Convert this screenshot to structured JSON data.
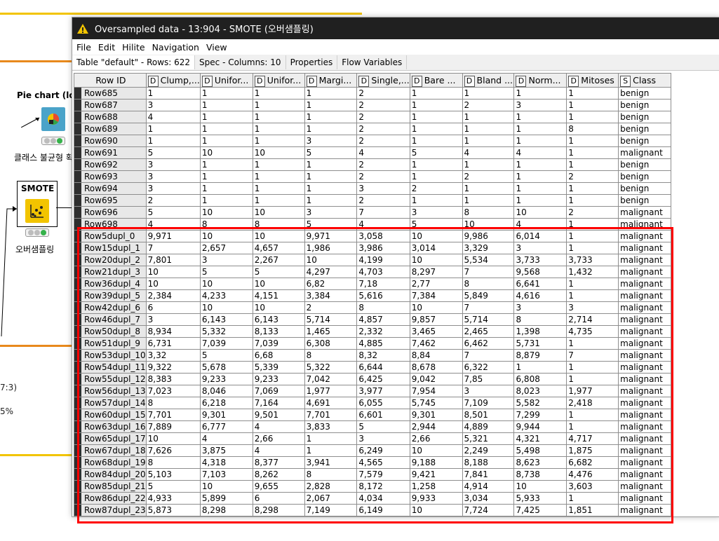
{
  "workflow": {
    "pie_node": {
      "title": "Pie chart (loca",
      "label": "클래스 불균형 확"
    },
    "smote_node": {
      "title": "SMOTE",
      "label": "오버샘플링"
    },
    "side_text": [
      "7:3)",
      "",
      "5%"
    ]
  },
  "window": {
    "title": "Oversampled data - 13:904 - SMOTE (오버샘플링)",
    "menu": [
      "File",
      "Edit",
      "Hilite",
      "Navigation",
      "View"
    ],
    "tabs": [
      "Table \"default\" - Rows: 622",
      "Spec - Columns: 10",
      "Properties",
      "Flow Variables"
    ]
  },
  "table": {
    "columns": [
      {
        "type": "",
        "name": "Row ID"
      },
      {
        "type": "D",
        "name": "Clump,..."
      },
      {
        "type": "D",
        "name": "Unifor..."
      },
      {
        "type": "D",
        "name": "Unifor..."
      },
      {
        "type": "D",
        "name": "Margi..."
      },
      {
        "type": "D",
        "name": "Single,..."
      },
      {
        "type": "D",
        "name": "Bare ..."
      },
      {
        "type": "D",
        "name": "Bland ..."
      },
      {
        "type": "D",
        "name": "Norm..."
      },
      {
        "type": "D",
        "name": "Mitoses"
      },
      {
        "type": "S",
        "name": "Class"
      }
    ],
    "rows": [
      [
        "Row685",
        "1",
        "1",
        "1",
        "1",
        "2",
        "1",
        "1",
        "1",
        "1",
        "benign"
      ],
      [
        "Row687",
        "3",
        "1",
        "1",
        "1",
        "2",
        "1",
        "2",
        "3",
        "1",
        "benign"
      ],
      [
        "Row688",
        "4",
        "1",
        "1",
        "1",
        "2",
        "1",
        "1",
        "1",
        "1",
        "benign"
      ],
      [
        "Row689",
        "1",
        "1",
        "1",
        "1",
        "2",
        "1",
        "1",
        "1",
        "8",
        "benign"
      ],
      [
        "Row690",
        "1",
        "1",
        "1",
        "3",
        "2",
        "1",
        "1",
        "1",
        "1",
        "benign"
      ],
      [
        "Row691",
        "5",
        "10",
        "10",
        "5",
        "4",
        "5",
        "4",
        "4",
        "1",
        "malignant"
      ],
      [
        "Row692",
        "3",
        "1",
        "1",
        "1",
        "2",
        "1",
        "1",
        "1",
        "1",
        "benign"
      ],
      [
        "Row693",
        "3",
        "1",
        "1",
        "1",
        "2",
        "1",
        "2",
        "1",
        "2",
        "benign"
      ],
      [
        "Row694",
        "3",
        "1",
        "1",
        "1",
        "3",
        "2",
        "1",
        "1",
        "1",
        "benign"
      ],
      [
        "Row695",
        "2",
        "1",
        "1",
        "1",
        "2",
        "1",
        "1",
        "1",
        "1",
        "benign"
      ],
      [
        "Row696",
        "5",
        "10",
        "10",
        "3",
        "7",
        "3",
        "8",
        "10",
        "2",
        "malignant"
      ],
      [
        "Row698",
        "4",
        "8",
        "8",
        "5",
        "4",
        "5",
        "10",
        "4",
        "1",
        "malignant"
      ],
      [
        "Row5dupl_0",
        "9,971",
        "10",
        "10",
        "9,971",
        "3,058",
        "10",
        "9,986",
        "6,014",
        "1",
        "malignant"
      ],
      [
        "Row15dupl_1",
        "7",
        "2,657",
        "4,657",
        "1,986",
        "3,986",
        "3,014",
        "3,329",
        "3",
        "1",
        "malignant"
      ],
      [
        "Row20dupl_2",
        "7,801",
        "3",
        "2,267",
        "10",
        "4,199",
        "10",
        "5,534",
        "3,733",
        "3,733",
        "malignant"
      ],
      [
        "Row21dupl_3",
        "10",
        "5",
        "5",
        "4,297",
        "4,703",
        "8,297",
        "7",
        "9,568",
        "1,432",
        "malignant"
      ],
      [
        "Row36dupl_4",
        "10",
        "10",
        "10",
        "6,82",
        "7,18",
        "2,77",
        "8",
        "6,641",
        "1",
        "malignant"
      ],
      [
        "Row39dupl_5",
        "2,384",
        "4,233",
        "4,151",
        "3,384",
        "5,616",
        "7,384",
        "5,849",
        "4,616",
        "1",
        "malignant"
      ],
      [
        "Row42dupl_6",
        "6",
        "10",
        "10",
        "2",
        "8",
        "10",
        "7",
        "3",
        "3",
        "malignant"
      ],
      [
        "Row46dupl_7",
        "3",
        "6,143",
        "6,143",
        "5,714",
        "4,857",
        "9,857",
        "5,714",
        "8",
        "2,714",
        "malignant"
      ],
      [
        "Row50dupl_8",
        "8,934",
        "5,332",
        "8,133",
        "1,465",
        "2,332",
        "3,465",
        "2,465",
        "1,398",
        "4,735",
        "malignant"
      ],
      [
        "Row51dupl_9",
        "6,731",
        "7,039",
        "7,039",
        "6,308",
        "4,885",
        "7,462",
        "6,462",
        "5,731",
        "1",
        "malignant"
      ],
      [
        "Row53dupl_10",
        "3,32",
        "5",
        "6,68",
        "8",
        "8,32",
        "8,84",
        "7",
        "8,879",
        "7",
        "malignant"
      ],
      [
        "Row54dupl_11",
        "9,322",
        "5,678",
        "5,339",
        "5,322",
        "6,644",
        "8,678",
        "6,322",
        "1",
        "1",
        "malignant"
      ],
      [
        "Row55dupl_12",
        "8,383",
        "9,233",
        "9,233",
        "7,042",
        "6,425",
        "9,042",
        "7,85",
        "6,808",
        "1",
        "malignant"
      ],
      [
        "Row56dupl_13",
        "7,023",
        "8,046",
        "7,069",
        "1,977",
        "3,977",
        "7,954",
        "3",
        "8,023",
        "1,977",
        "malignant"
      ],
      [
        "Row57dupl_14",
        "8",
        "6,218",
        "7,164",
        "4,691",
        "6,055",
        "5,745",
        "7,109",
        "5,582",
        "2,418",
        "malignant"
      ],
      [
        "Row60dupl_15",
        "7,701",
        "9,301",
        "9,501",
        "7,701",
        "6,601",
        "9,301",
        "8,501",
        "7,299",
        "1",
        "malignant"
      ],
      [
        "Row63dupl_16",
        "7,889",
        "6,777",
        "4",
        "3,833",
        "5",
        "2,944",
        "4,889",
        "9,944",
        "1",
        "malignant"
      ],
      [
        "Row65dupl_17",
        "10",
        "4",
        "2,66",
        "1",
        "3",
        "2,66",
        "5,321",
        "4,321",
        "4,717",
        "malignant"
      ],
      [
        "Row67dupl_18",
        "7,626",
        "3,875",
        "4",
        "1",
        "6,249",
        "10",
        "2,249",
        "5,498",
        "1,875",
        "malignant"
      ],
      [
        "Row68dupl_19",
        "8",
        "4,318",
        "8,377",
        "3,941",
        "4,565",
        "9,188",
        "8,188",
        "8,623",
        "6,682",
        "malignant"
      ],
      [
        "Row84dupl_20",
        "5,103",
        "7,103",
        "8,262",
        "8",
        "7,579",
        "9,421",
        "7,841",
        "8,738",
        "4,476",
        "malignant"
      ],
      [
        "Row85dupl_21",
        "5",
        "10",
        "9,655",
        "2,828",
        "8,172",
        "1,258",
        "4,914",
        "10",
        "3,603",
        "malignant"
      ],
      [
        "Row86dupl_22",
        "4,933",
        "5,899",
        "6",
        "2,067",
        "4,034",
        "9,933",
        "3,034",
        "5,933",
        "1",
        "malignant"
      ],
      [
        "Row87dupl_23",
        "5,873",
        "8,298",
        "8,298",
        "7,149",
        "6,149",
        "10",
        "7,724",
        "7,425",
        "1,851",
        "malignant"
      ]
    ]
  },
  "colors": {
    "highlight": "#ff0000",
    "titlebar": "#202020",
    "accent_orange": "#e8891c",
    "accent_yellow": "#f2c400"
  }
}
